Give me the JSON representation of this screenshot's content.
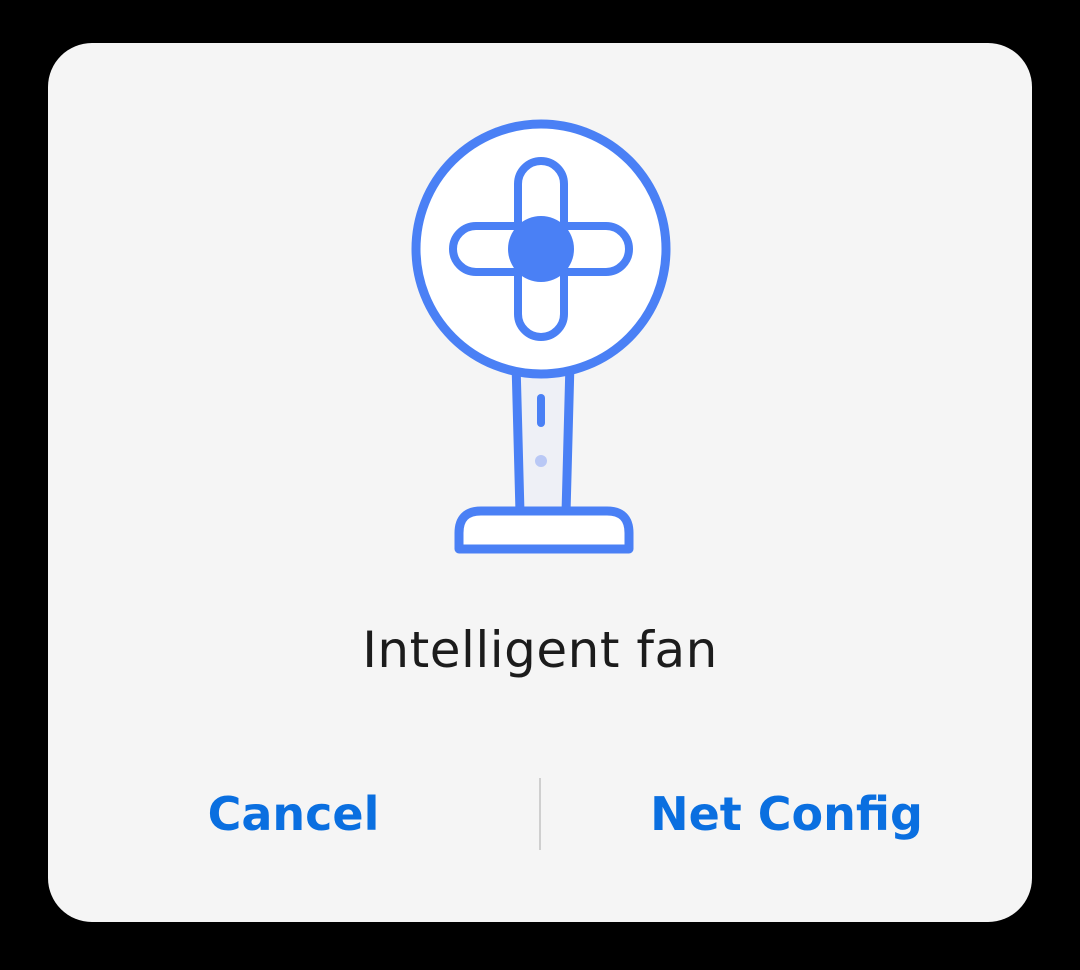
{
  "dialog": {
    "device_name": "Intelligent fan",
    "device_icon": "standing-fan-icon",
    "cancel_label": "Cancel",
    "confirm_label": "Net Config"
  },
  "colors": {
    "accent": "#0a6fe0",
    "icon_stroke": "#4a80f5",
    "icon_light": "#b9c8f5",
    "dialog_bg": "#f5f5f5"
  }
}
